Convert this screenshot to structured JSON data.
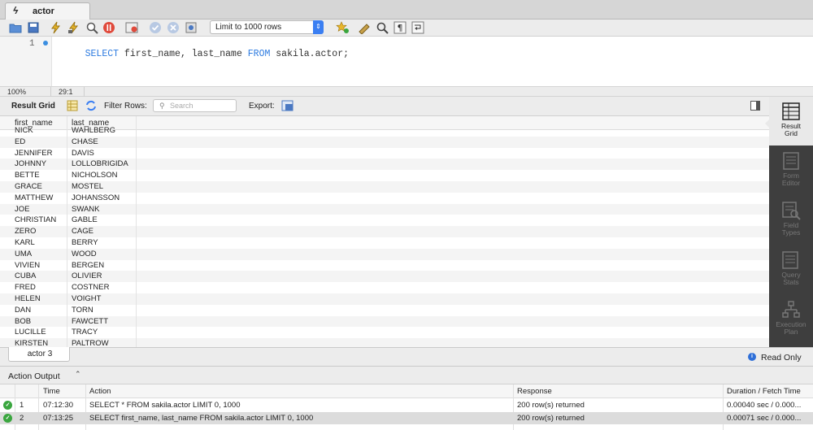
{
  "tab": {
    "title": "actor"
  },
  "toolbar": {
    "limit_value": "Limit to 1000 rows"
  },
  "editor": {
    "line_number": "1",
    "sql": [
      {
        "t": "SELECT",
        "kw": true
      },
      {
        "t": " first_name, last_name ",
        "kw": false
      },
      {
        "t": "FROM",
        "kw": true
      },
      {
        "t": " sakila.actor;",
        "kw": false
      }
    ]
  },
  "status": {
    "zoom": "100%",
    "cursor": "29:1"
  },
  "result_toolbar": {
    "result_grid_label": "Result Grid",
    "filter_label": "Filter Rows:",
    "filter_placeholder": "Search",
    "export_label": "Export:"
  },
  "grid": {
    "columns": [
      "first_name",
      "last_name"
    ],
    "rows": [
      [
        "NICK",
        "WAHLBERG"
      ],
      [
        "ED",
        "CHASE"
      ],
      [
        "JENNIFER",
        "DAVIS"
      ],
      [
        "JOHNNY",
        "LOLLOBRIGIDA"
      ],
      [
        "BETTE",
        "NICHOLSON"
      ],
      [
        "GRACE",
        "MOSTEL"
      ],
      [
        "MATTHEW",
        "JOHANSSON"
      ],
      [
        "JOE",
        "SWANK"
      ],
      [
        "CHRISTIAN",
        "GABLE"
      ],
      [
        "ZERO",
        "CAGE"
      ],
      [
        "KARL",
        "BERRY"
      ],
      [
        "UMA",
        "WOOD"
      ],
      [
        "VIVIEN",
        "BERGEN"
      ],
      [
        "CUBA",
        "OLIVIER"
      ],
      [
        "FRED",
        "COSTNER"
      ],
      [
        "HELEN",
        "VOIGHT"
      ],
      [
        "DAN",
        "TORN"
      ],
      [
        "BOB",
        "FAWCETT"
      ],
      [
        "LUCILLE",
        "TRACY"
      ],
      [
        "KIRSTEN",
        "PALTROW"
      ]
    ]
  },
  "side_panel": {
    "items": [
      {
        "label1": "Result",
        "label2": "Grid",
        "icon": "result-grid-icon",
        "active": true
      },
      {
        "label1": "Form",
        "label2": "Editor",
        "icon": "form-editor-icon",
        "active": false
      },
      {
        "label1": "Field",
        "label2": "Types",
        "icon": "field-types-icon",
        "active": false
      },
      {
        "label1": "Query",
        "label2": "Stats",
        "icon": "query-stats-icon",
        "active": false
      },
      {
        "label1": "Execution",
        "label2": "Plan",
        "icon": "execution-plan-icon",
        "active": false
      }
    ]
  },
  "result_tab": {
    "label": "actor 3",
    "read_only": "Read Only"
  },
  "action_output": {
    "label": "Action Output",
    "columns": {
      "time": "Time",
      "action": "Action",
      "response": "Response",
      "duration": "Duration / Fetch Time"
    },
    "rows": [
      {
        "num": "1",
        "time": "07:12:30",
        "action": "SELECT * FROM sakila.actor LIMIT 0, 1000",
        "response": "200 row(s) returned",
        "duration": "0.00040 sec / 0.000...",
        "selected": false
      },
      {
        "num": "2",
        "time": "07:13:25",
        "action": "SELECT first_name, last_name FROM sakila.actor LIMIT 0, 1000",
        "response": "200 row(s) returned",
        "duration": "0.00071 sec / 0.000...",
        "selected": true
      }
    ]
  },
  "colors": {
    "keyword": "#2d7be0",
    "accent": "#3b7ff2",
    "ok": "#3aa63f",
    "panel": "#3e3e3e"
  }
}
